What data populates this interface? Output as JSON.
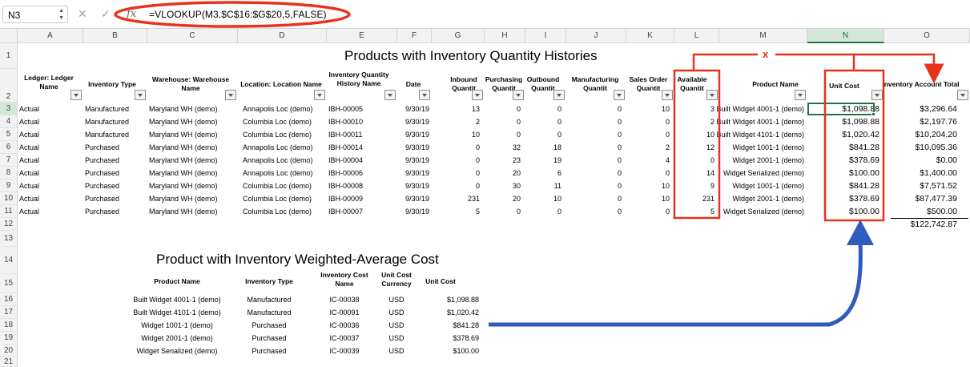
{
  "formula_bar": {
    "name_box": "N3",
    "cancel_icon": "✕",
    "enter_icon": "✓",
    "fx_icon": "fx",
    "formula": "=VLOOKUP(M3,$C$16:$G$20,5,FALSE)"
  },
  "columns": [
    "A",
    "B",
    "C",
    "D",
    "E",
    "F",
    "G",
    "H",
    "I",
    "J",
    "K",
    "L",
    "M",
    "N",
    "O"
  ],
  "selected_column": "N",
  "rows": [
    "1",
    "2",
    "3",
    "4",
    "5",
    "6",
    "7",
    "8",
    "9",
    "10",
    "11",
    "12",
    "13",
    "14",
    "15",
    "16",
    "17",
    "18",
    "19",
    "20",
    "21"
  ],
  "selected_row": "3",
  "table1": {
    "title": "Products with Inventory Quantity Histories",
    "headers": {
      "a": "Ledger: Ledger Name",
      "b": "Inventory Type",
      "c": "Warehouse: Warehouse Name",
      "d": "Location: Location Name",
      "e": "Inventory Quantity History Name",
      "f": "Date",
      "g": "Inbound Quantit",
      "h": "Purchasing Quantit",
      "i": "Outbound Quantit",
      "j": "Manufacturing Quantit",
      "k": "Sales Order Quantit",
      "l": "Available Quantit",
      "m": "Product Name",
      "n": "Unit Cost",
      "o": "Inventory Account Total"
    },
    "rows": [
      {
        "a": "Actual",
        "b": "Manufactured",
        "c": "Maryland WH (demo)",
        "d": "Annapolis Loc (demo)",
        "e": "IBH-00005",
        "f": "9/30/19",
        "g": "13",
        "h": "0",
        "i": "0",
        "j": "0",
        "k": "10",
        "l": "3",
        "m": "Built Widget 4001-1 (demo)",
        "n": "$1,098.88",
        "o": "$3,296.64"
      },
      {
        "a": "Actual",
        "b": "Manufactured",
        "c": "Maryland WH (demo)",
        "d": "Columbia Loc (demo)",
        "e": "IBH-00010",
        "f": "9/30/19",
        "g": "2",
        "h": "0",
        "i": "0",
        "j": "0",
        "k": "0",
        "l": "2",
        "m": "Built Widget 4001-1 (demo)",
        "n": "$1,098.88",
        "o": "$2,197.76"
      },
      {
        "a": "Actual",
        "b": "Manufactured",
        "c": "Maryland WH (demo)",
        "d": "Columbia Loc (demo)",
        "e": "IBH-00011",
        "f": "9/30/19",
        "g": "10",
        "h": "0",
        "i": "0",
        "j": "0",
        "k": "0",
        "l": "10",
        "m": "Built Widget 4101-1 (demo)",
        "n": "$1,020.42",
        "o": "$10,204.20"
      },
      {
        "a": "Actual",
        "b": "Purchased",
        "c": "Maryland WH (demo)",
        "d": "Annapolis Loc (demo)",
        "e": "IBH-00014",
        "f": "9/30/19",
        "g": "0",
        "h": "32",
        "i": "18",
        "j": "0",
        "k": "2",
        "l": "12",
        "m": "Widget 1001-1 (demo)",
        "n": "$841.28",
        "o": "$10,095.36"
      },
      {
        "a": "Actual",
        "b": "Purchased",
        "c": "Maryland WH (demo)",
        "d": "Annapolis Loc (demo)",
        "e": "IBH-00004",
        "f": "9/30/19",
        "g": "0",
        "h": "23",
        "i": "19",
        "j": "0",
        "k": "4",
        "l": "0",
        "m": "Widget 2001-1 (demo)",
        "n": "$378.69",
        "o": "$0.00"
      },
      {
        "a": "Actual",
        "b": "Purchased",
        "c": "Maryland WH (demo)",
        "d": "Annapolis Loc (demo)",
        "e": "IBH-00006",
        "f": "9/30/19",
        "g": "0",
        "h": "20",
        "i": "6",
        "j": "0",
        "k": "0",
        "l": "14",
        "m": "Widget Serialized (demo)",
        "n": "$100.00",
        "o": "$1,400.00"
      },
      {
        "a": "Actual",
        "b": "Purchased",
        "c": "Maryland WH (demo)",
        "d": "Columbia Loc (demo)",
        "e": "IBH-00008",
        "f": "9/30/19",
        "g": "0",
        "h": "30",
        "i": "11",
        "j": "0",
        "k": "10",
        "l": "9",
        "m": "Widget 1001-1 (demo)",
        "n": "$841.28",
        "o": "$7,571.52"
      },
      {
        "a": "Actual",
        "b": "Purchased",
        "c": "Maryland WH (demo)",
        "d": "Columbia Loc (demo)",
        "e": "IBH-00009",
        "f": "9/30/19",
        "g": "231",
        "h": "20",
        "i": "10",
        "j": "0",
        "k": "10",
        "l": "231",
        "m": "Widget 2001-1 (demo)",
        "n": "$378.69",
        "o": "$87,477.39"
      },
      {
        "a": "Actual",
        "b": "Purchased",
        "c": "Maryland WH (demo)",
        "d": "Columbia Loc (demo)",
        "e": "IBH-00007",
        "f": "9/30/19",
        "g": "5",
        "h": "0",
        "i": "0",
        "j": "0",
        "k": "0",
        "l": "5",
        "m": "Widget Serialized (demo)",
        "n": "$100.00",
        "o": "$500.00"
      }
    ],
    "total": "$122,742.87"
  },
  "table2": {
    "title": "Product with Inventory Weighted-Average Cost",
    "headers": {
      "product": "Product Name",
      "type": "Inventory Type",
      "cost_name": "Inventory Cost Name",
      "currency": "Unit Cost Currency",
      "unit_cost": "Unit Cost"
    },
    "rows": [
      {
        "product": "Built Widget 4001-1 (demo)",
        "type": "Manufactured",
        "cost_name": "IC-00038",
        "currency": "USD",
        "unit_cost": "$1,098.88"
      },
      {
        "product": "Built Widget 4101-1 (demo)",
        "type": "Manufactured",
        "cost_name": "IC-00091",
        "currency": "USD",
        "unit_cost": "$1,020.42"
      },
      {
        "product": "Widget 1001-1 (demo)",
        "type": "Purchased",
        "cost_name": "IC-00036",
        "currency": "USD",
        "unit_cost": "$841.28"
      },
      {
        "product": "Widget 2001-1 (demo)",
        "type": "Purchased",
        "cost_name": "IC-00037",
        "currency": "USD",
        "unit_cost": "$378.69"
      },
      {
        "product": "Widget Serialized (demo)",
        "type": "Purchased",
        "cost_name": "IC-00039",
        "currency": "USD",
        "unit_cost": "$100.00"
      }
    ]
  },
  "annotations": {
    "x_mark": "x",
    "red_color": "#e8321e",
    "blue_color": "#2f5bbd"
  },
  "colors": {
    "excel_green": "#217346",
    "header_bg": "#f2f2f2"
  }
}
